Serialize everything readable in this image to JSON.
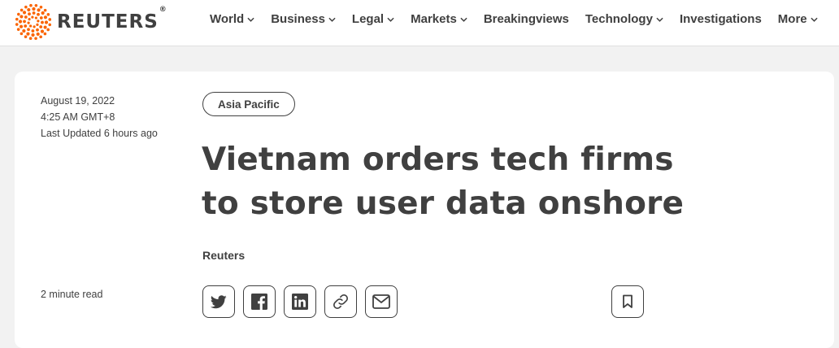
{
  "brand": {
    "name": "REUTERS",
    "reg": "®",
    "accent": "#fa6400"
  },
  "nav": [
    {
      "label": "World",
      "dropdown": true
    },
    {
      "label": "Business",
      "dropdown": true
    },
    {
      "label": "Legal",
      "dropdown": true
    },
    {
      "label": "Markets",
      "dropdown": true
    },
    {
      "label": "Breakingviews",
      "dropdown": false
    },
    {
      "label": "Technology",
      "dropdown": true
    },
    {
      "label": "Investigations",
      "dropdown": false
    },
    {
      "label": "More",
      "dropdown": true
    }
  ],
  "article": {
    "date": "August 19, 2022",
    "time": "4:25 AM GMT+8",
    "updated": "Last Updated 6 hours ago",
    "read_time": "2 minute read",
    "tag": "Asia Pacific",
    "headline": "Vietnam orders tech firms to store user data onshore",
    "byline": "Reuters"
  },
  "share_icons": [
    "twitter-icon",
    "facebook-icon",
    "linkedin-icon",
    "link-icon",
    "email-icon",
    "bookmark-icon"
  ]
}
